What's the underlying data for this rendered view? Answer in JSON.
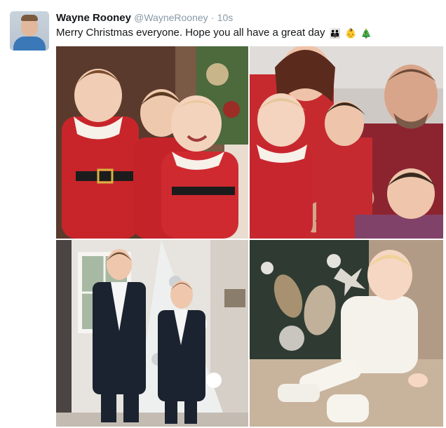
{
  "tweet": {
    "display_name": "Wayne Rooney",
    "handle": "@WayneRooney",
    "separator": "·",
    "time": "10s",
    "text": "Merry Christmas everyone. Hope you all have a great day",
    "emojis": [
      {
        "name": "family-emoji",
        "glyph": "👪"
      },
      {
        "name": "baby-emoji",
        "glyph": "👶"
      },
      {
        "name": "christmas-tree-emoji",
        "glyph": "🎄"
      }
    ]
  }
}
